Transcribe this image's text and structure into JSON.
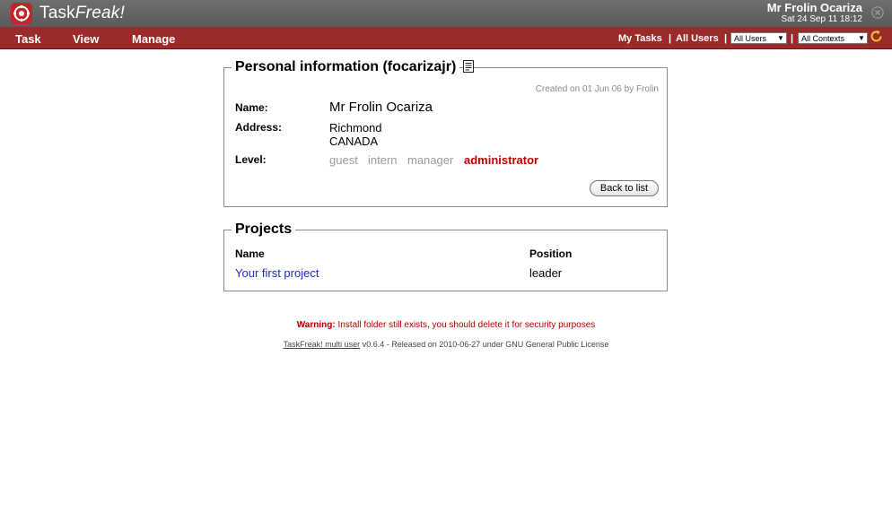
{
  "header": {
    "app_name_part1": "Task",
    "app_name_part2": "Freak!",
    "user_name": "Mr Frolin Ocariza",
    "datetime": "Sat 24 Sep 11 18:12"
  },
  "menu": {
    "items": [
      "Task",
      "View",
      "Manage"
    ],
    "my_tasks": "My Tasks",
    "all_users": "All Users",
    "separator": "|",
    "user_filter": "All Users",
    "context_filter": "All Contexts"
  },
  "personal": {
    "title": "Personal information (focarizajr)",
    "created": "Created on 01 Jun 06 by Frolin",
    "name_label": "Name:",
    "name_value": "Mr Frolin Ocariza",
    "address_label": "Address:",
    "address_line1": "Richmond",
    "address_line2": "CANADA",
    "level_label": "Level:",
    "levels": [
      "guest",
      "intern",
      "manager",
      "administrator"
    ],
    "active_level": "administrator",
    "back_button": "Back to list"
  },
  "projects": {
    "title": "Projects",
    "col_name": "Name",
    "col_position": "Position",
    "rows": [
      {
        "name": "Your first project",
        "position": "leader"
      }
    ]
  },
  "warning": {
    "label": "Warning:",
    "text": "Install folder still exists, you should delete it for security purposes"
  },
  "footer": {
    "product_link": "TaskFreak! multi user",
    "text": "v0.6.4 - Released on 2010-06-27 under GNU General Public License"
  },
  "colors": {
    "menu_bar": "#9b2a2a",
    "active_level": "#c00000",
    "link": "#1a2fb5"
  }
}
